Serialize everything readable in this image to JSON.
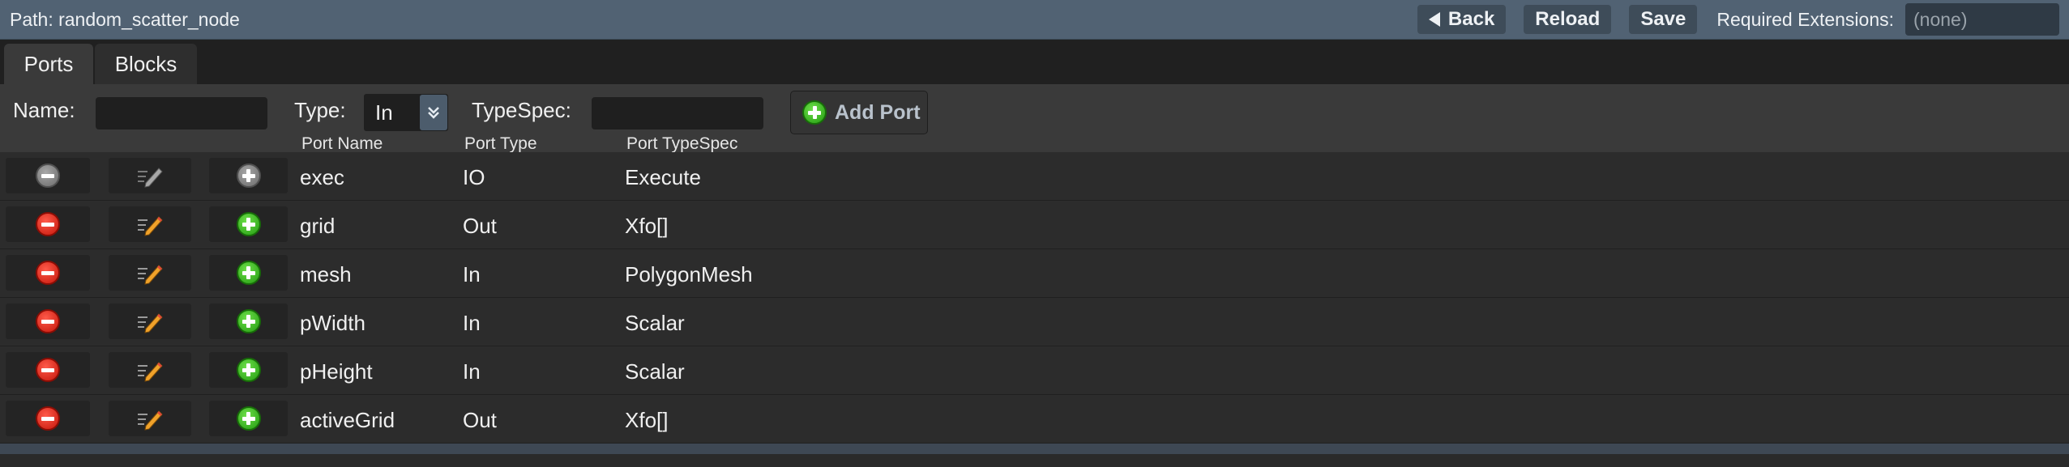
{
  "header": {
    "path_text": "Path: random_scatter_node",
    "back_label": "Back",
    "reload_label": "Reload",
    "save_label": "Save",
    "required_extensions_label": "Required Extensions:",
    "required_extensions_value": "(none)"
  },
  "tabs": [
    {
      "label": "Ports",
      "active": true
    },
    {
      "label": "Blocks",
      "active": false
    }
  ],
  "form": {
    "name_label": "Name:",
    "name_value": "",
    "type_label": "Type:",
    "type_value": "In",
    "typespec_label": "TypeSpec:",
    "typespec_value": "",
    "add_port_label": "Add Port"
  },
  "columns": {
    "port_name": "Port Name",
    "port_type": "Port Type",
    "port_typespec": "Port TypeSpec"
  },
  "ports": [
    {
      "name": "exec",
      "type": "IO",
      "typespec": "Execute",
      "editable": false
    },
    {
      "name": "grid",
      "type": "Out",
      "typespec": "Xfo[]",
      "editable": true
    },
    {
      "name": "mesh",
      "type": "In",
      "typespec": "PolygonMesh",
      "editable": true
    },
    {
      "name": "pWidth",
      "type": "In",
      "typespec": "Scalar",
      "editable": true
    },
    {
      "name": "pHeight",
      "type": "In",
      "typespec": "Scalar",
      "editable": true
    },
    {
      "name": "activeGrid",
      "type": "Out",
      "typespec": "Xfo[]",
      "editable": true
    }
  ],
  "colors": {
    "header_bg": "#516273",
    "remove_red": "#d7261a",
    "add_green": "#2fb317",
    "disabled_gray": "#8a8a8a"
  }
}
